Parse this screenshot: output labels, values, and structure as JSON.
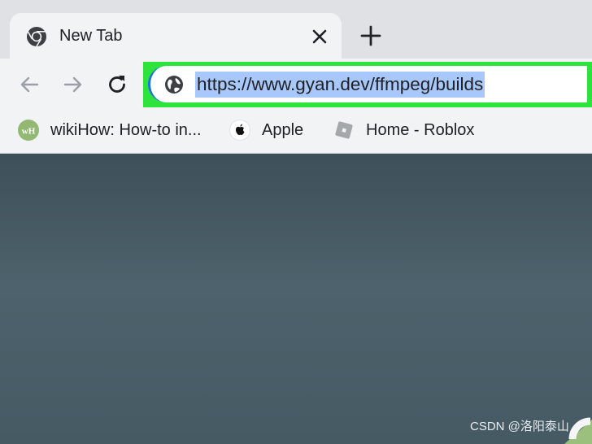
{
  "tab": {
    "title": "New Tab",
    "favicon": "chrome-icon",
    "close_icon": "close-icon"
  },
  "tabstrip": {
    "new_tab_icon": "plus-icon"
  },
  "toolbar": {
    "back_icon": "arrow-left-icon",
    "forward_icon": "arrow-right-icon",
    "reload_icon": "reload-icon",
    "site_info_icon": "globe-icon",
    "url": "https://www.gyan.dev/ffmpeg/builds",
    "highlight_color": "#2ee33c",
    "selection_color": "#a8c7fa"
  },
  "bookmarks": [
    {
      "label": "wikiHow: How-to in...",
      "icon": "wikihow-icon"
    },
    {
      "label": "Apple",
      "icon": "apple-icon"
    },
    {
      "label": "Home - Roblox",
      "icon": "roblox-icon"
    }
  ],
  "watermark": {
    "text": "CSDN @洛阳泰山"
  }
}
